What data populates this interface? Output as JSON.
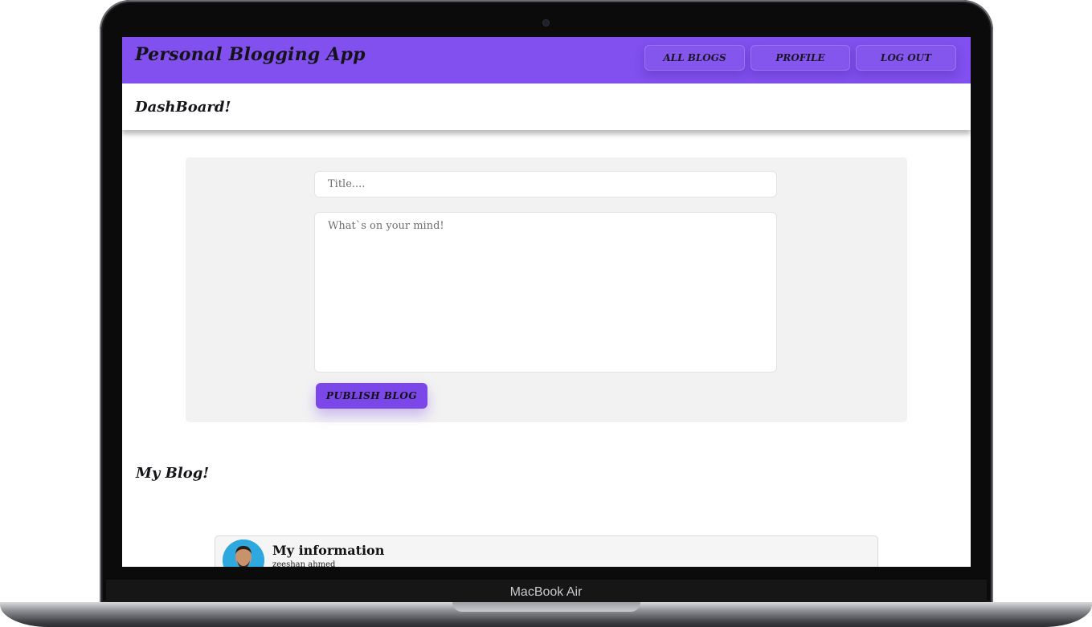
{
  "navbar": {
    "app_title": "Personal Blogging App",
    "buttons": [
      "ALL BLOGS",
      "PROFILE",
      "LOG OUT"
    ],
    "accent_color": "#8150ee"
  },
  "dashboard": {
    "title": "DashBoard!"
  },
  "composer": {
    "title_placeholder": "Title....",
    "body_placeholder": "What`s on your mind!",
    "publish_label": "PUBLISH BLOG"
  },
  "my_blog": {
    "heading": "My Blog!",
    "posts": [
      {
        "title": "My information",
        "author": "zeeshan ahmed",
        "avatar_icon": "user-avatar"
      }
    ]
  },
  "device": {
    "label": "MacBook Air"
  }
}
